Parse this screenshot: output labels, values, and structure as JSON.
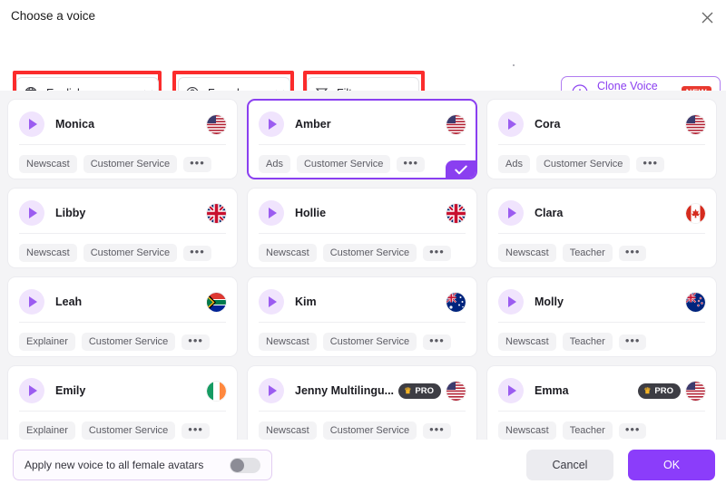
{
  "header": {
    "title": "Choose a voice",
    "close_icon": "close-icon"
  },
  "controls": {
    "language": {
      "icon": "globe-icon",
      "value": "English",
      "chevron": "chevron-down-icon"
    },
    "gender": {
      "icon": "user-circle-icon",
      "value": "Female",
      "chevron": "chevron-down-icon"
    },
    "filter": {
      "icon": "filter-icon",
      "label": "Filter",
      "more": "•••"
    },
    "clone": {
      "icon": "plus-circle-icon",
      "label": "Clone Voice Now",
      "badge": "NEW"
    }
  },
  "colors": {
    "accent_purple": "#8a3ff0",
    "ok_button": "#8b3dfa",
    "annotation_red": "#fb2c2c",
    "badge_new_red": "#e8392f",
    "grid_background": "#f4f4f6"
  },
  "voices": [
    {
      "name": "Monica",
      "flag": "us",
      "pro": false,
      "selected": false,
      "tags": [
        "Newscast",
        "Customer Service"
      ]
    },
    {
      "name": "Amber",
      "flag": "us",
      "pro": false,
      "selected": true,
      "tags": [
        "Ads",
        "Customer Service"
      ]
    },
    {
      "name": "Cora",
      "flag": "us",
      "pro": false,
      "selected": false,
      "tags": [
        "Ads",
        "Customer Service"
      ]
    },
    {
      "name": "Libby",
      "flag": "gb",
      "pro": false,
      "selected": false,
      "tags": [
        "Newscast",
        "Customer Service"
      ]
    },
    {
      "name": "Hollie",
      "flag": "gb",
      "pro": false,
      "selected": false,
      "tags": [
        "Newscast",
        "Customer Service"
      ]
    },
    {
      "name": "Clara",
      "flag": "ca",
      "pro": false,
      "selected": false,
      "tags": [
        "Newscast",
        "Teacher"
      ]
    },
    {
      "name": "Leah",
      "flag": "za",
      "pro": false,
      "selected": false,
      "tags": [
        "Explainer",
        "Customer Service"
      ]
    },
    {
      "name": "Kim",
      "flag": "au",
      "pro": false,
      "selected": false,
      "tags": [
        "Newscast",
        "Customer Service"
      ]
    },
    {
      "name": "Molly",
      "flag": "nz",
      "pro": false,
      "selected": false,
      "tags": [
        "Newscast",
        "Teacher"
      ]
    },
    {
      "name": "Emily",
      "flag": "ie",
      "pro": false,
      "selected": false,
      "tags": [
        "Explainer",
        "Customer Service"
      ]
    },
    {
      "name": "Jenny Multilingu...",
      "flag": "us",
      "pro": true,
      "selected": false,
      "tags": [
        "Newscast",
        "Customer Service"
      ]
    },
    {
      "name": "Emma",
      "flag": "us",
      "pro": true,
      "selected": false,
      "tags": [
        "Newscast",
        "Teacher"
      ]
    }
  ],
  "card_labels": {
    "pro_badge": "PRO",
    "more_tags": "•••",
    "play_icon": "play-icon"
  },
  "footer": {
    "apply_label": "Apply new voice to all female avatars",
    "toggle_state": "off",
    "cancel_label": "Cancel",
    "ok_label": "OK"
  }
}
